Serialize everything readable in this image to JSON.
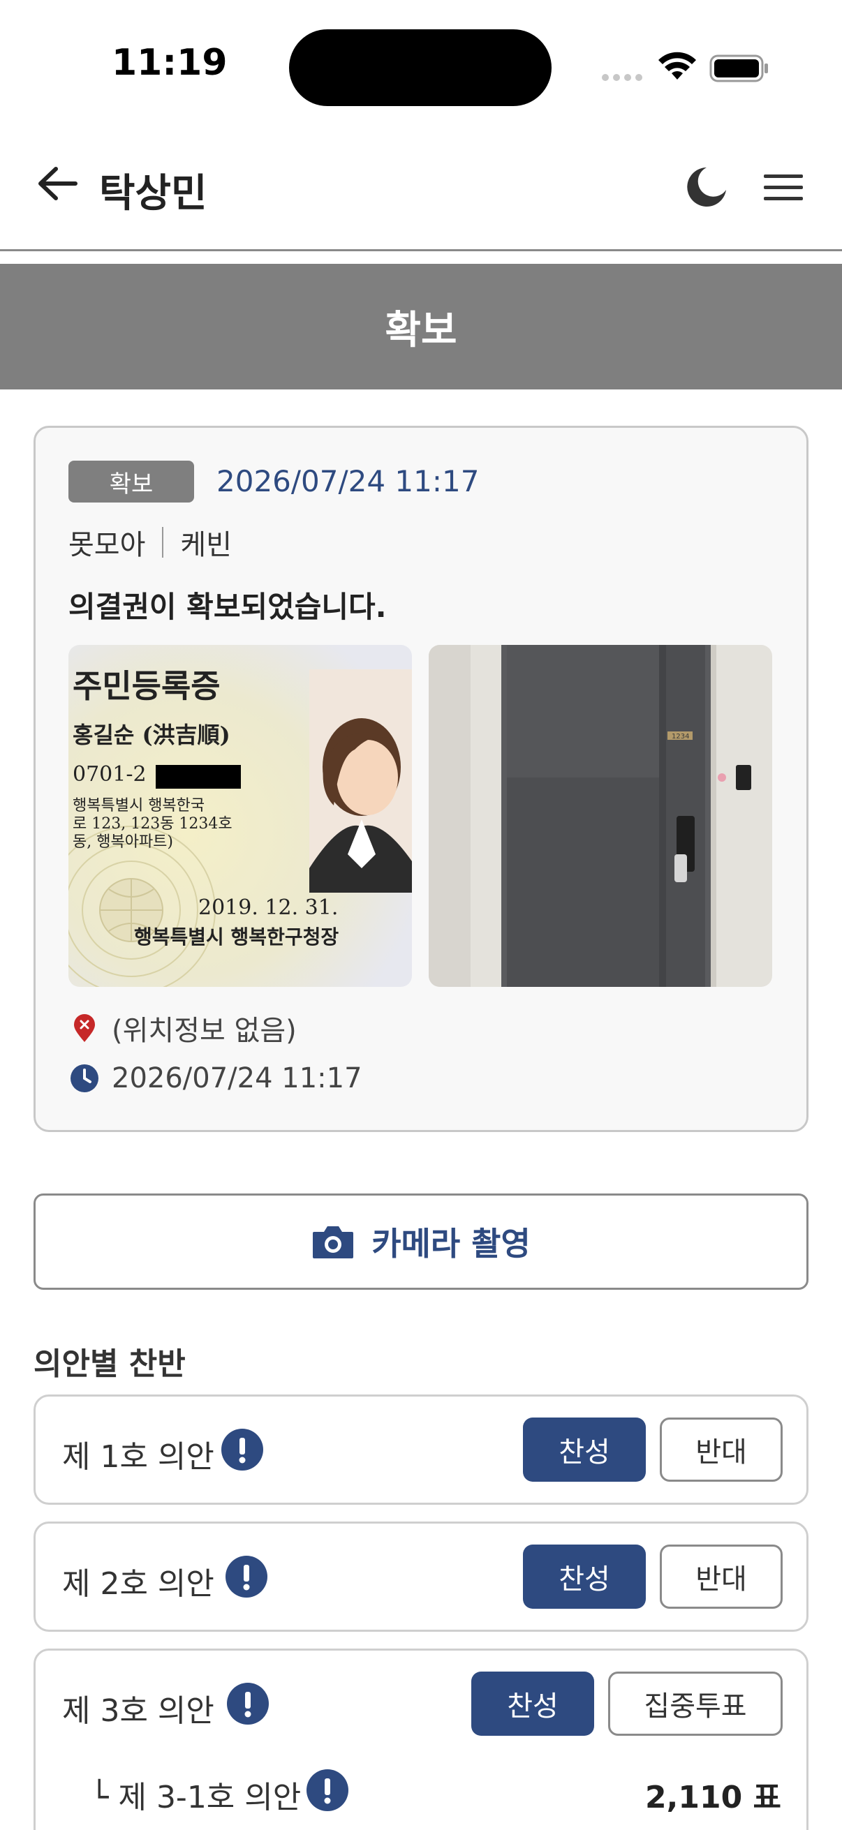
{
  "status_bar": {
    "time": "11:19"
  },
  "header": {
    "title": "탁상민"
  },
  "banner": {
    "title": "확보"
  },
  "card": {
    "badge": "확보",
    "datetime": "2026/07/24 11:17",
    "meta_left": "못모아",
    "meta_right": "케빈",
    "message": "의결권이 확보되었습니다.",
    "location": "(위치정보 없음)",
    "timestamp": "2026/07/24 11:17",
    "id_card": {
      "title": "주민등록증",
      "name": "홍길순 (洪吉順)",
      "id_number": "0701-2",
      "address_1": "행복특별시 행복한국",
      "address_2": "로 123, 123동 1234호",
      "address_3": "동, 행복아파트)",
      "issue_date": "2019. 12. 31.",
      "issuer": "행복특별시 행복한구청장"
    },
    "door_sign": "1234"
  },
  "camera_button": {
    "label": "카메라 촬영"
  },
  "section": {
    "title": "의안별 찬반"
  },
  "agendas": [
    {
      "label": "제 1호 의안",
      "yes": "찬성",
      "no": "반대"
    },
    {
      "label": "제 2호 의안",
      "yes": "찬성",
      "no": "반대"
    },
    {
      "label": "제 3호 의안",
      "yes": "찬성",
      "no": "집중투표",
      "sub": {
        "label": "└ 제 3-1호 의안",
        "count": "2,110 표"
      }
    }
  ],
  "colors": {
    "accent": "#2e4a80",
    "banner": "#7f7f7f",
    "location_pin": "#c62828"
  }
}
